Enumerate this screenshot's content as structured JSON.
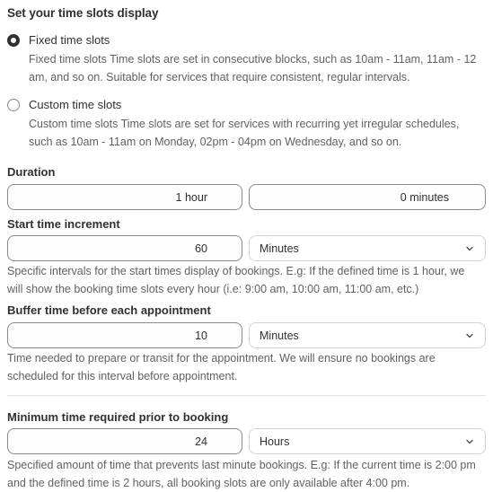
{
  "display": {
    "title": "Set your time slots display",
    "options": [
      {
        "label": "Fixed time slots",
        "selected": true,
        "description_line1": "Fixed time slots Time slots are set in consecutive blocks, such as 10am - 11am, 11am - 12",
        "description_line2": "am, and so on. Suitable for services that require consistent, regular intervals."
      },
      {
        "label": "Custom time slots",
        "selected": false,
        "description_line1": "Custom time slots Time slots are set for services with recurring yet irregular schedules,",
        "description_line2": "such as 10am - 11am on Monday, 02pm - 04pm on Wednesday, and so on."
      }
    ]
  },
  "duration": {
    "label": "Duration",
    "hours_value": "1 hour",
    "minutes_value": "0 minutes"
  },
  "start_increment": {
    "label": "Start time increment",
    "value": "60",
    "unit": "Minutes",
    "help_line1": "Specific intervals for the start times display of bookings. E.g: If the defined time is 1 hour, we",
    "help_line2": "will show the booking time slots every hour (i.e: 9:00 am, 10:00 am, 11:00 am, etc.)"
  },
  "buffer": {
    "label": "Buffer time before each appointment",
    "value": "10",
    "unit": "Minutes",
    "help_line1": "Time needed to prepare or transit for the appointment. We will ensure no bookings are",
    "help_line2": "scheduled for this interval before appointment."
  },
  "minimum_notice": {
    "label": "Minimum time required prior to booking",
    "value": "24",
    "unit": "Hours",
    "help_line1": "Specified amount of time that prevents last minute bookings. E.g: If the current time is 2:00 pm",
    "help_line2": "and the defined time is 2 hours, all booking slots are only available after 4:00 pm."
  }
}
